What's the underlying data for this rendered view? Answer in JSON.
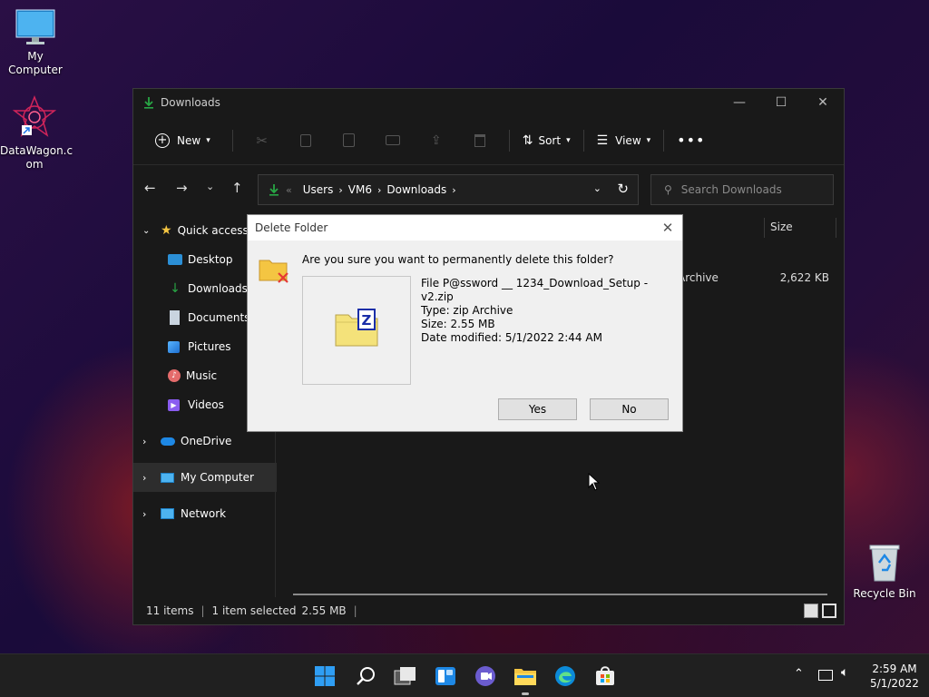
{
  "desktop": {
    "icons": [
      {
        "label": "My Computer"
      },
      {
        "label": "DataWagon.c om"
      },
      {
        "label": "Recycle Bin"
      }
    ]
  },
  "explorer": {
    "title": "Downloads",
    "toolbar": {
      "new": "New",
      "sort": "Sort",
      "view": "View"
    },
    "address": {
      "crumbs": [
        "Users",
        "VM6",
        "Downloads"
      ]
    },
    "search_placeholder": "Search Downloads",
    "column_size": "Size",
    "nav": {
      "quick_access": "Quick access",
      "items": [
        "Desktop",
        "Downloads",
        "Documents",
        "Pictures",
        "Music",
        "Videos"
      ],
      "onedrive": "OneDrive",
      "mycomputer": "My Computer",
      "network": "Network"
    },
    "row": {
      "type_partial": "Archive",
      "size": "2,622 KB"
    },
    "status": {
      "items": "11 items",
      "selected": "1 item selected",
      "size": "2.55 MB"
    }
  },
  "dialog": {
    "title": "Delete Folder",
    "question": "Are you sure you want to permanently delete this folder?",
    "file": "File P@ssword __ 1234_Download_Setup - v2.zip",
    "type": "Type: zip Archive",
    "size": "Size: 2.55 MB",
    "date": "Date modified: 5/1/2022 2:44 AM",
    "yes": "Yes",
    "no": "No"
  },
  "taskbar": {
    "time": "2:59 AM",
    "date": "5/1/2022"
  },
  "colors": {
    "accent": "#0078d4",
    "folder": "#f4c542",
    "green": "#28a745"
  }
}
